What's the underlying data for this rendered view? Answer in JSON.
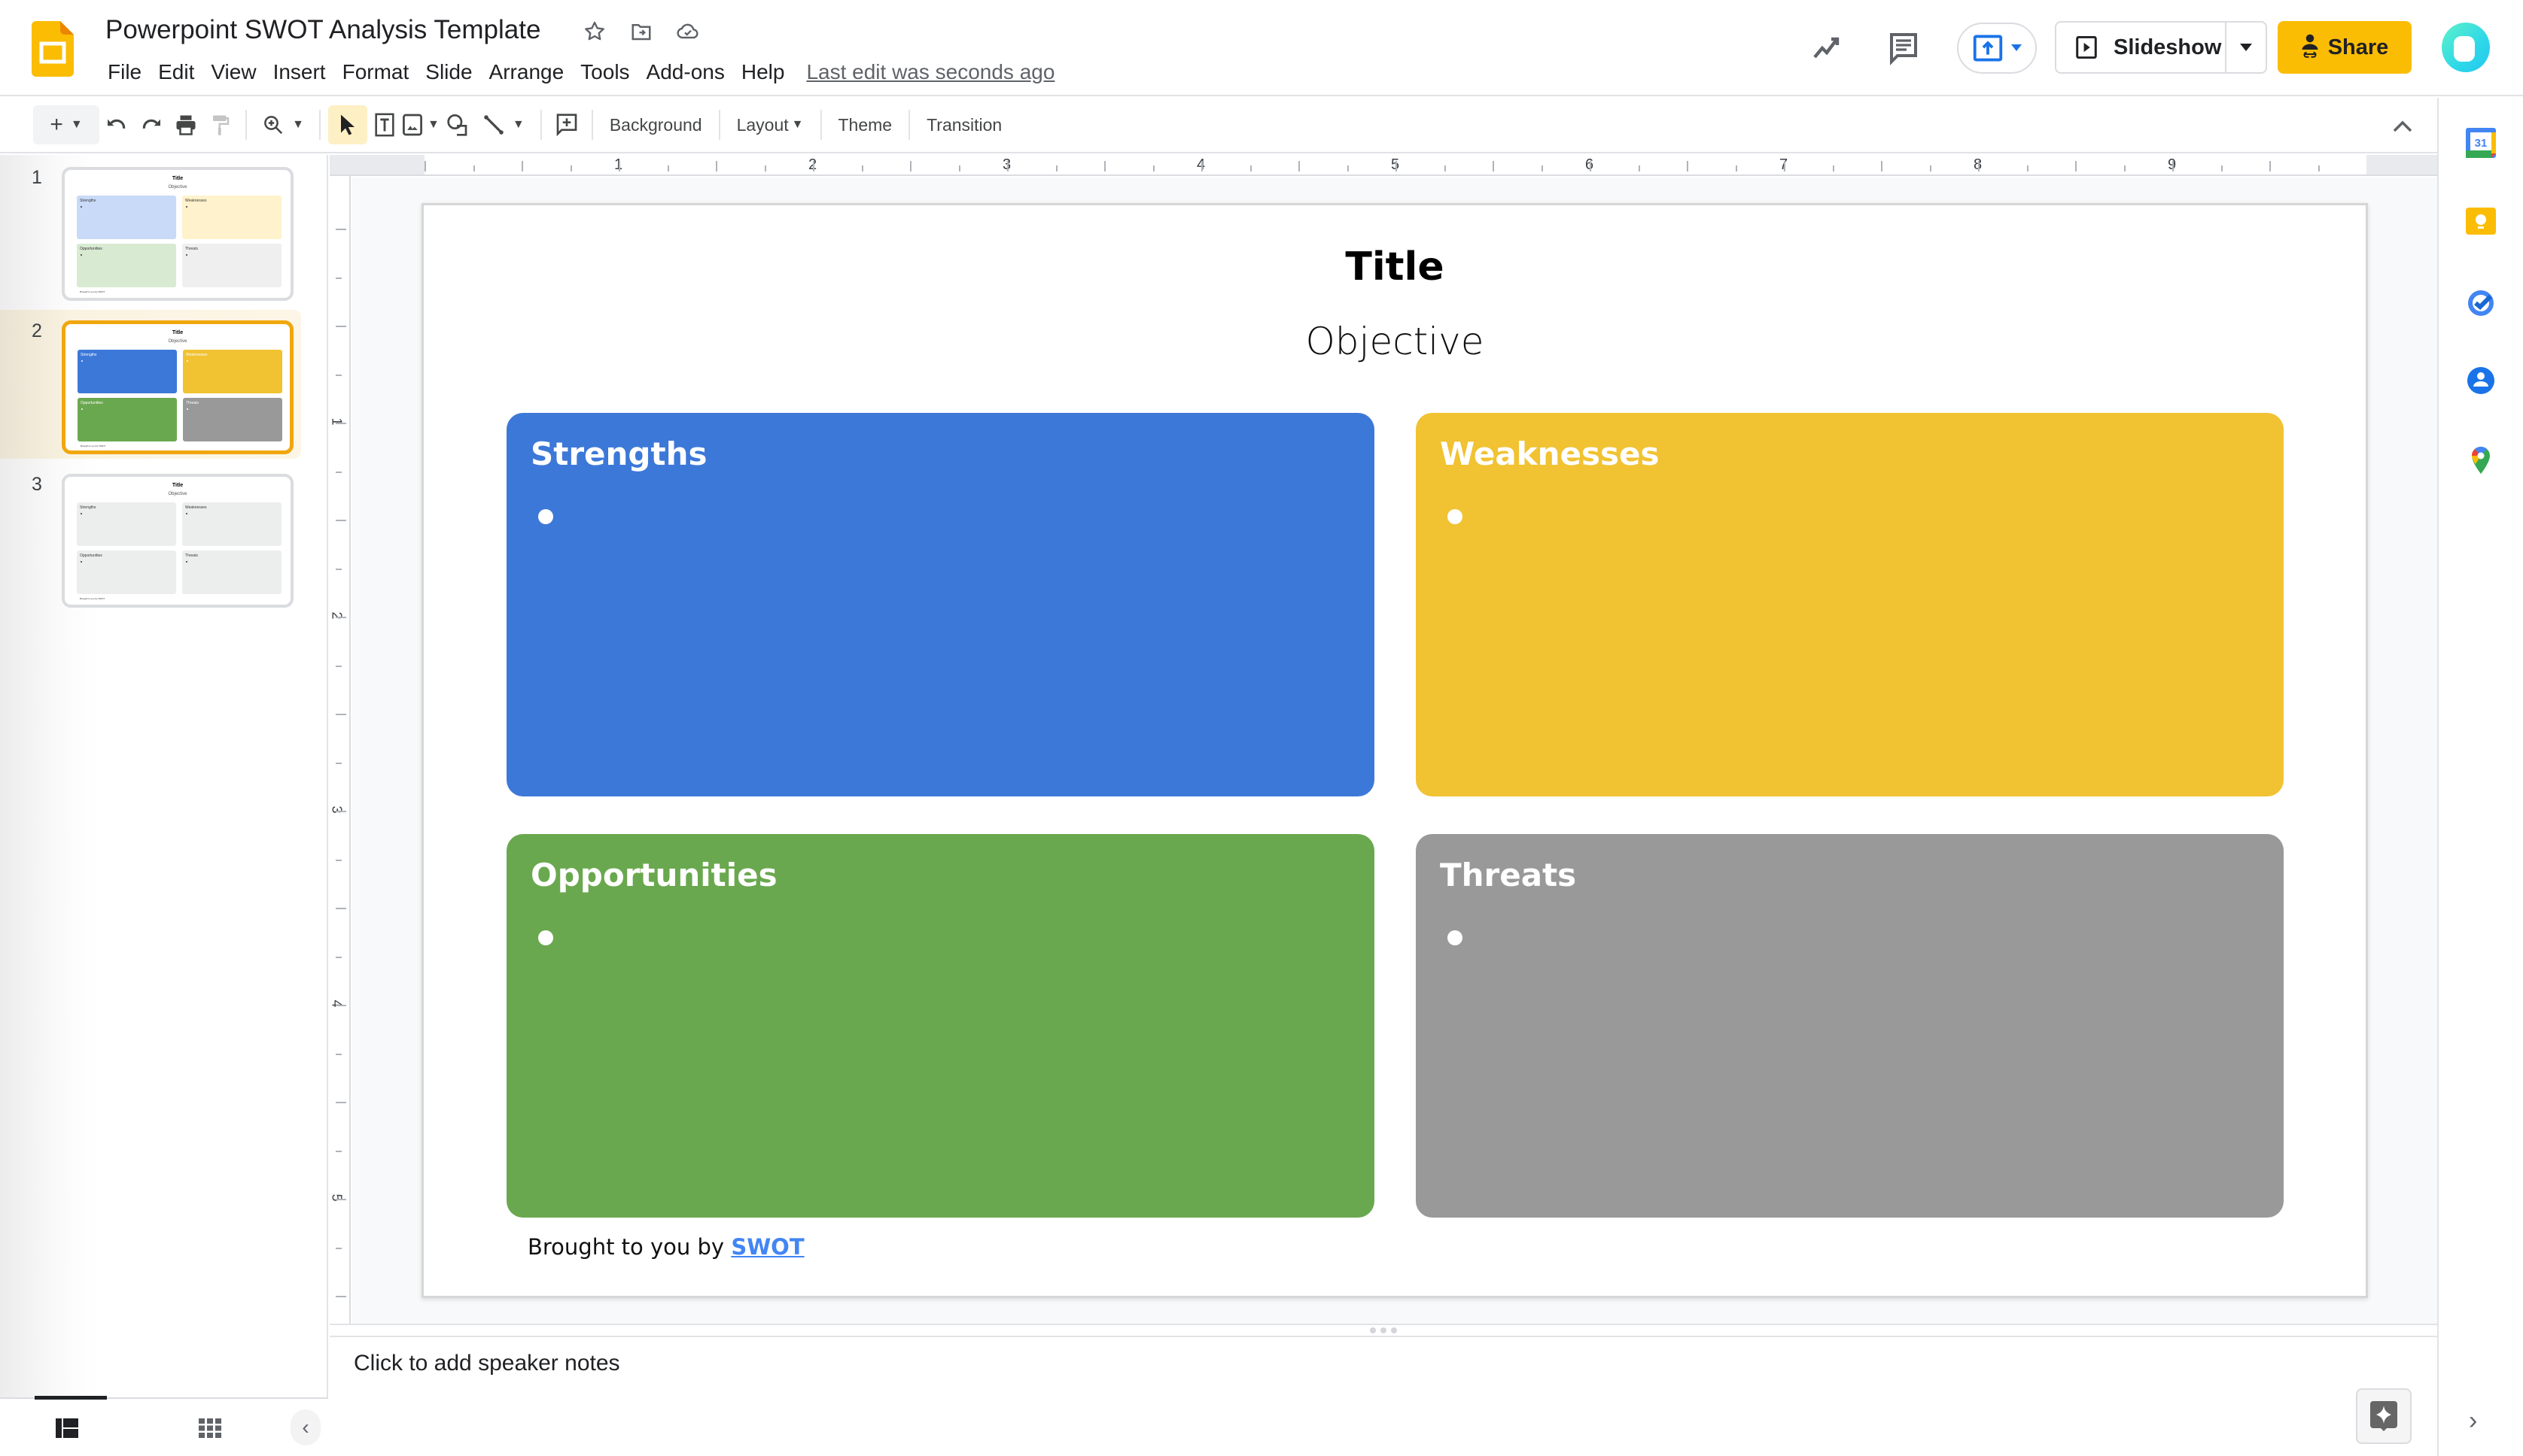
{
  "header": {
    "doc_title": "Powerpoint SWOT Analysis Template",
    "title_icons": [
      "star-icon",
      "move-to-folder-icon",
      "cloud-saved-icon"
    ],
    "menu": [
      "File",
      "Edit",
      "View",
      "Insert",
      "Format",
      "Slide",
      "Arrange",
      "Tools",
      "Add-ons",
      "Help"
    ],
    "last_edit": "Last edit was seconds ago",
    "slideshow_label": "Slideshow",
    "share_label": "Share",
    "colors": {
      "share": "#fbbc04",
      "present_accent": "#1a73e8"
    }
  },
  "toolbar": {
    "background_label": "Background",
    "layout_label": "Layout",
    "theme_label": "Theme",
    "transition_label": "Transition"
  },
  "filmstrip": {
    "selected_index": 2,
    "slides": [
      {
        "number": "1",
        "title": "Title",
        "objective": "Objective",
        "labels": [
          "Strengths",
          "Weaknesses",
          "Opportunities",
          "Threats"
        ],
        "colors": [
          "#c9daf8",
          "#fff2cc",
          "#d9ead3",
          "#efefef"
        ],
        "footer": "Brought to you by SWOT"
      },
      {
        "number": "2",
        "title": "Title",
        "objective": "Objective",
        "labels": [
          "Strengths",
          "Weaknesses",
          "Opportunities",
          "Threats"
        ],
        "colors": [
          "#3c78d8",
          "#f1c232",
          "#6aa84f",
          "#999999"
        ],
        "footer": "Brought to you by SWOT"
      },
      {
        "number": "3",
        "title": "Title",
        "objective": "Objective",
        "labels": [
          "Strengths",
          "Weaknesses",
          "Opportunities",
          "Threats"
        ],
        "colors": [
          "#eceeed",
          "#eceeed",
          "#eceeed",
          "#eceeed"
        ],
        "footer": "Brought to you by SWOT"
      }
    ]
  },
  "ruler": {
    "horizontal": [
      "1",
      "2",
      "3",
      "4",
      "5",
      "6",
      "7",
      "8",
      "9"
    ],
    "vertical": [
      "1",
      "2",
      "3",
      "4",
      "5"
    ]
  },
  "slide": {
    "title": "Title",
    "objective": "Objective",
    "quadrants": [
      {
        "label": "Strengths",
        "color": "#3c78d8"
      },
      {
        "label": "Weaknesses",
        "color": "#f1c232"
      },
      {
        "label": "Opportunities",
        "color": "#6aa84f"
      },
      {
        "label": "Threats",
        "color": "#999999"
      }
    ],
    "footer_prefix": "Brought to you by ",
    "footer_link": "SWOT"
  },
  "notes": {
    "placeholder": "Click to add speaker notes"
  },
  "side_panel": {
    "apps": [
      "calendar-icon",
      "keep-icon",
      "tasks-icon",
      "contacts-icon",
      "maps-icon"
    ],
    "calendar_day": "31"
  }
}
